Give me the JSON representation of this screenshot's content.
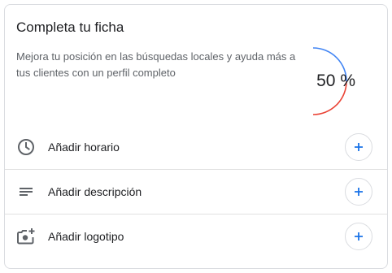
{
  "card": {
    "title": "Completa tu ficha",
    "description": "Mejora tu posición en las búsquedas locales y ayuda más a tus clientes con un perfil completo",
    "progress": {
      "label": "50 %",
      "fraction": 0.5,
      "colors": {
        "complete": "#4285f4",
        "remaining": "#ea4335"
      }
    }
  },
  "tasks": [
    {
      "label": "Añadir horario",
      "icon": "clock-icon",
      "action_icon": "plus-icon"
    },
    {
      "label": "Añadir descripción",
      "icon": "short-text-icon",
      "action_icon": "plus-icon"
    },
    {
      "label": "Añadir logotipo",
      "icon": "add-photo-icon",
      "action_icon": "plus-icon"
    }
  ],
  "colors": {
    "accent": "#1a73e8",
    "text_primary": "#202124",
    "text_secondary": "#5f6368",
    "icon": "#5f6368",
    "border": "#dadce0"
  }
}
